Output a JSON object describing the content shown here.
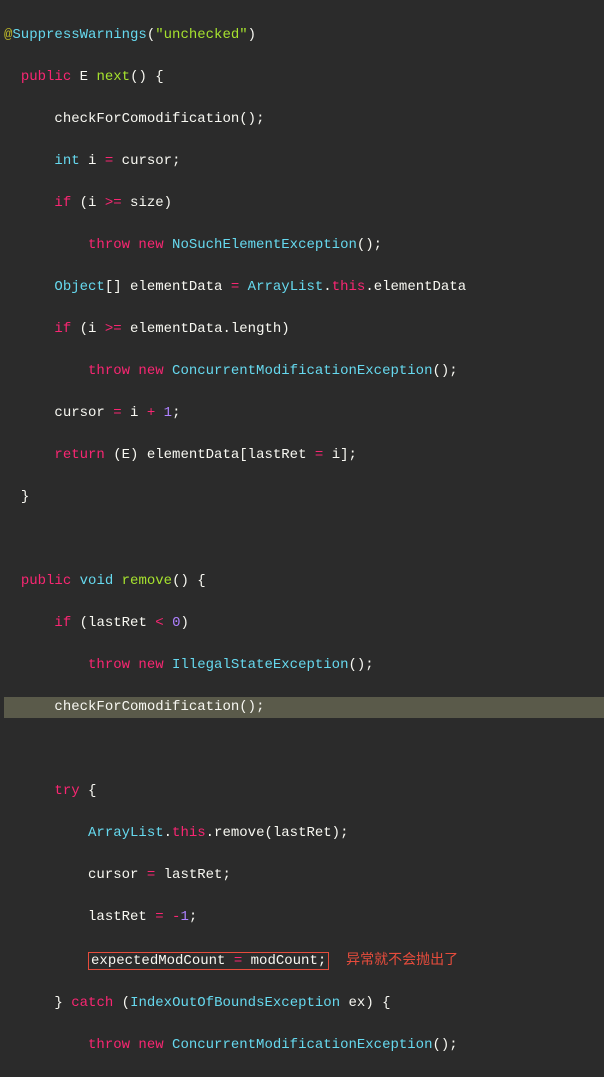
{
  "code": {
    "l1_at": "@",
    "l1_ann": "SuppressWarnings",
    "l1_p1": "(",
    "l1_str": "\"unchecked\"",
    "l1_p2": ")",
    "l2_pub": "public",
    "l2_E": " E ",
    "l2_next": "next",
    "l2_tail": "() {",
    "l3": "checkForComodification",
    "l3_tail": "();",
    "l4_int": "int",
    "l4_rest": " i ",
    "l4_eq": "=",
    "l4_cur": " cursor;",
    "l5_if": "if",
    "l5_p": " (i ",
    "l5_ge": ">=",
    "l5_size": " size)",
    "l6_throw": "throw",
    "l6_new": " new",
    "l6_exc": " NoSuchElementException",
    "l6_tail": "();",
    "l7_obj": "Object",
    "l7_br": "[] elementData ",
    "l7_eq": "=",
    "l7_al": " ArrayList",
    "l7_dot": ".",
    "l7_this": "this",
    "l7_tail": ".elementData",
    "l8_if": "if",
    "l8_p": " (i ",
    "l8_ge": ">=",
    "l8_rest": " elementData.length)",
    "l9_throw": "throw",
    "l9_new": " new",
    "l9_exc": " ConcurrentModificationException",
    "l9_tail": "();",
    "l10_a": "cursor ",
    "l10_eq": "=",
    "l10_b": " i ",
    "l10_plus": "+",
    "l10_c": " ",
    "l10_one": "1",
    "l10_semi": ";",
    "l11_ret": "return",
    "l11_cast": " (E) elementData[lastRet ",
    "l11_eq": "=",
    "l11_tail": " i];",
    "l12": "}",
    "l14_pub": "public",
    "l14_void": " void",
    "l14_rem": " remove",
    "l14_tail": "() {",
    "l15_if": "if",
    "l15_p": " (lastRet ",
    "l15_lt": "<",
    "l15_sp": " ",
    "l15_zero": "0",
    "l15_cp": ")",
    "l16_throw": "throw",
    "l16_new": " new",
    "l16_exc": " IllegalStateException",
    "l16_tail": "();",
    "l17": "checkForComodification",
    "l17_tail": "();",
    "l19_try": "try",
    "l19_b": " {",
    "l20_al": "ArrayList",
    "l20_dot": ".",
    "l20_this": "this",
    "l20_rem": ".remove(lastRet);",
    "l21_a": "cursor ",
    "l21_eq": "=",
    "l21_b": " lastRet;",
    "l22_a": "lastRet ",
    "l22_eq": "=",
    "l22_sp": " ",
    "l22_neg": "-",
    "l22_one": "1",
    "l22_semi": ";",
    "l23_a": "expectedModCount ",
    "l23_eq": "=",
    "l23_b": " modCount;",
    "l23_comment": "异常就不会抛出了",
    "l24_b": "} ",
    "l24_catch": "catch",
    "l24_p": " (",
    "l24_exc": "IndexOutOfBoundsException",
    "l24_tail": " ex) {",
    "l25_throw": "throw",
    "l25_new": " new",
    "l25_exc": " ConcurrentModificationException",
    "l25_tail": "();"
  }
}
